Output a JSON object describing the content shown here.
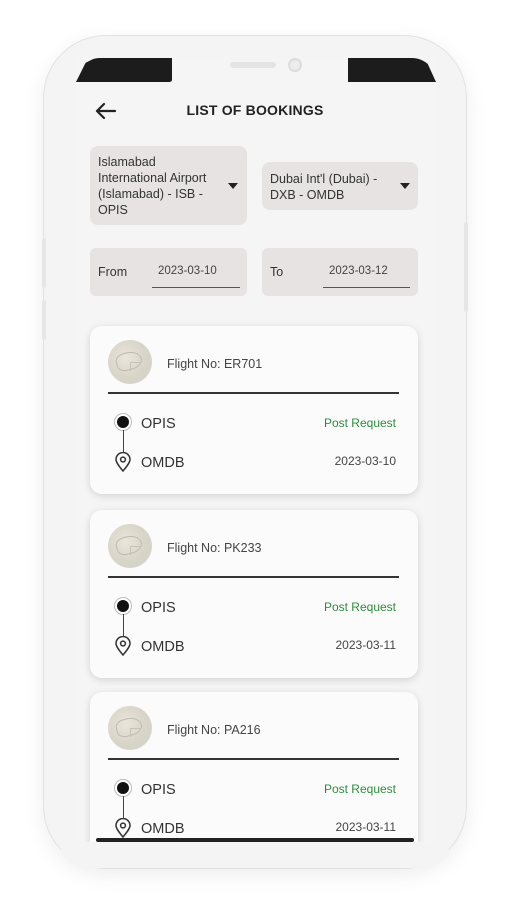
{
  "header": {
    "title": "LIST OF BOOKINGS",
    "back_icon": "arrow-left-icon"
  },
  "filters": {
    "origin": "Islamabad International Airport (Islamabad)  - ISB - OPIS",
    "destination": "Dubai Int'l (Dubai)  - DXB - OMDB",
    "from_label": "From",
    "from_value": "2023-03-10",
    "to_label": "To",
    "to_value": "2023-03-12"
  },
  "bookings": [
    {
      "flight_no": "Flight No: ER701",
      "origin": "OPIS",
      "destination": "OMDB",
      "status": "Post Request",
      "date": "2023-03-10"
    },
    {
      "flight_no": "Flight No: PK233",
      "origin": "OPIS",
      "destination": "OMDB",
      "status": "Post Request",
      "date": "2023-03-11"
    },
    {
      "flight_no": "Flight No: PA216",
      "origin": "OPIS",
      "destination": "OMDB",
      "status": "Post Request",
      "date": "2023-03-11"
    }
  ],
  "colors": {
    "status_green": "#2e8b3e",
    "field_bg": "#e7e3e3",
    "card_bg": "#fbfbfb"
  }
}
